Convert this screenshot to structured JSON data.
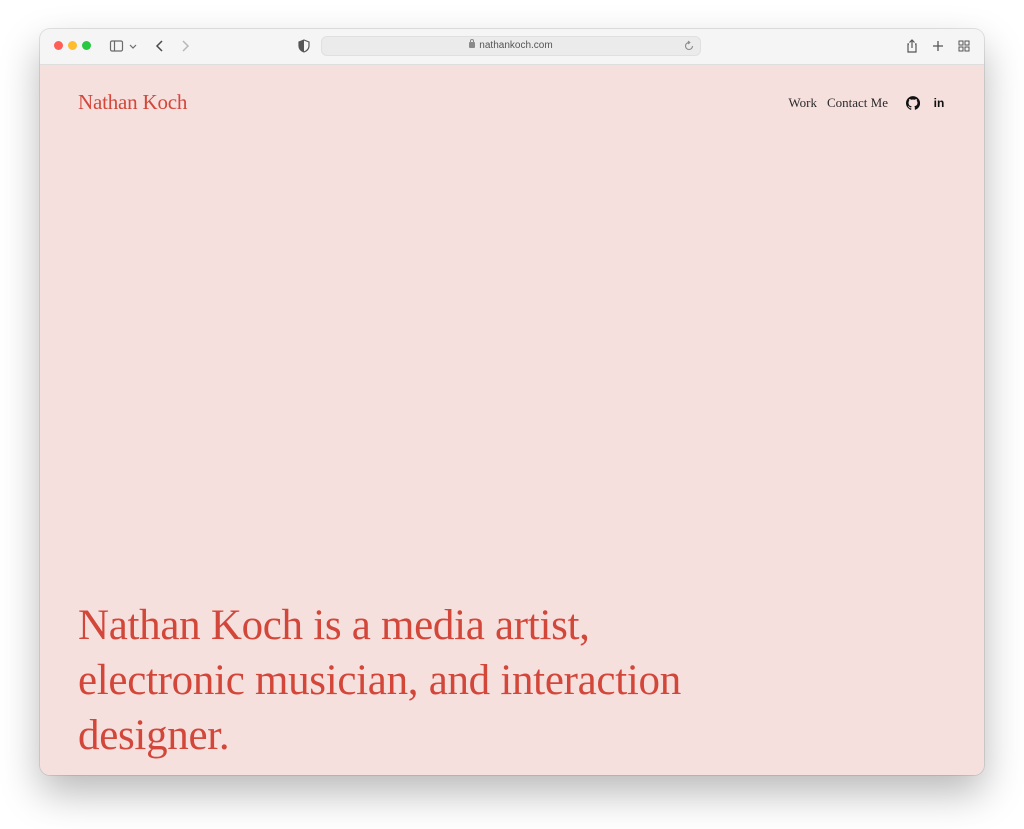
{
  "browser": {
    "url": "nathankoch.com",
    "traffic_lights": {
      "close_color": "#ff5f57",
      "minimize_color": "#febc2e",
      "zoom_color": "#28c840"
    },
    "icons": {
      "sidebar": "sidebar-icon",
      "sidebar_menu": "chevron-down-icon",
      "back": "chevron-left-icon",
      "forward": "chevron-right-icon",
      "privacy": "shield-icon",
      "lock": "lock-icon",
      "reload": "reload-icon",
      "share": "share-icon",
      "new_tab": "plus-icon",
      "tab_overview": "grid-icon"
    }
  },
  "site": {
    "logo": "Nathan Koch",
    "nav": {
      "work": "Work",
      "contact": "Contact Me",
      "github_icon": "github-icon",
      "linkedin_icon": "linkedin-icon",
      "linkedin_text": "in"
    },
    "hero": {
      "line1": "Nathan Koch is a media artist,",
      "line2": "electronic musician, and interaction",
      "line3": "designer."
    },
    "colors": {
      "background": "#f6e0de",
      "accent": "#d3473a",
      "nav_text": "#2a2a2a"
    }
  }
}
